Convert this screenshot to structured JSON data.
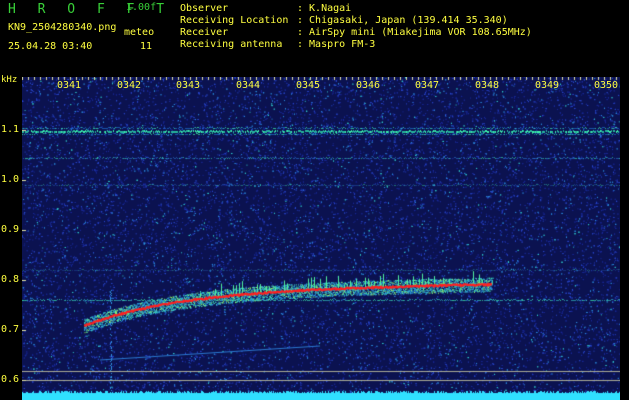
{
  "header": {
    "brand": "H R O F F T",
    "version": "1.00f",
    "filename": "KN9_2504280340.png",
    "meteo_label": "meteo",
    "datetime": "25.04.28 03:40",
    "count": "11",
    "info": [
      {
        "label": "Observer",
        "value": ": K.Nagai"
      },
      {
        "label": "Receiving Location",
        "value": ": Chigasaki, Japan (139.414 35.340)"
      },
      {
        "label": "Receiver",
        "value": ": AirSpy mini (Miakejima VOR 108.65MHz)"
      },
      {
        "label": "Receiving antenna",
        "value": ": Maspro FM-3"
      }
    ]
  },
  "spectrogram": {
    "y_unit": "kHz",
    "y_ticks": [
      "1.1",
      "1.0",
      "0.9",
      "0.8",
      "0.7",
      "0.6"
    ],
    "x_ticks": [
      "0341",
      "0342",
      "0343",
      "0344",
      "0345",
      "0346",
      "0347",
      "0348",
      "0349",
      "0350"
    ],
    "colors": {
      "background": "#0b1250",
      "signal": "#ff2020",
      "noise_high": "#40ffb0",
      "bottom_band": "#30e0ff",
      "grid": "#c8c8a0"
    }
  }
}
